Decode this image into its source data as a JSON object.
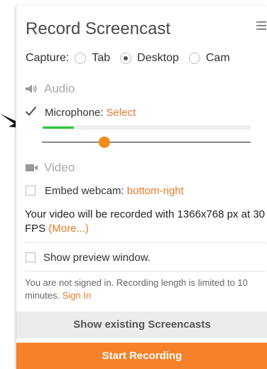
{
  "header": {
    "title": "Record Screencast"
  },
  "capture": {
    "label": "Capture:",
    "options": [
      "Tab",
      "Desktop",
      "Cam"
    ],
    "selected": "Desktop"
  },
  "audio": {
    "section_label": "Audio",
    "microphone_label": "Microphone:",
    "microphone_link": "Select",
    "microphone_checked": true,
    "level_fraction": 0.15,
    "volume_fraction": 0.3
  },
  "video": {
    "section_label": "Video",
    "webcam_label": "Embed webcam:",
    "webcam_link": "bottom-right",
    "webcam_checked": false
  },
  "info": {
    "recording_text": "Your video will be recorded with 1366x768 px at 30 FPS",
    "more_link": "(More...)"
  },
  "preview": {
    "label": "Show preview window.",
    "checked": false
  },
  "notice": {
    "text": "You are not signed in. Recording length is limited to 10 minutes.",
    "sign_in_link": "Sign In"
  },
  "buttons": {
    "show_existing": "Show existing Screencasts",
    "start_recording": "Start Recording"
  },
  "colors": {
    "accent": "#f5822a",
    "link": "#e8782b",
    "level": "#2ecc3a"
  }
}
